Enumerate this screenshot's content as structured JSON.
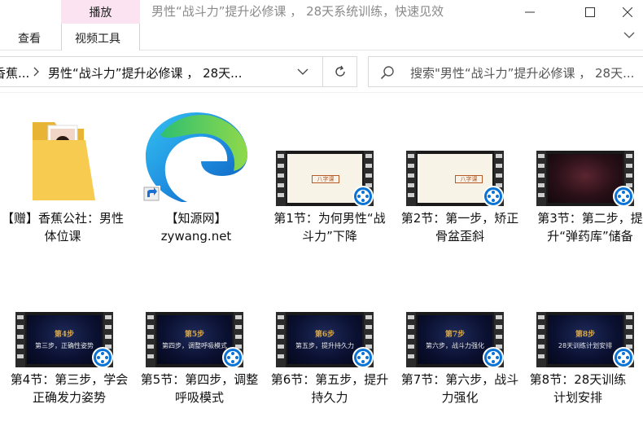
{
  "window": {
    "title": "男性“战斗力”提升必修课 ， 28天系统训练，快速见效",
    "contextual_tab": "播放",
    "minimize_icon": "minimize-icon",
    "maximize_icon": "maximize-icon",
    "close_icon": "close-icon"
  },
  "ribbon": {
    "tabs": [
      "查看",
      "视频工具"
    ]
  },
  "address": {
    "crumbs": [
      "香蕉...",
      "男性“战斗力”提升必修课 ， 28天..."
    ]
  },
  "search": {
    "placeholder": "搜索\"男性“战斗力”提升必修课 ， 28天..."
  },
  "items": [
    {
      "label": "【赠】香蕉公社：男性体位课",
      "type": "folder"
    },
    {
      "label": "【知源网】zywang.net",
      "type": "shortcut"
    },
    {
      "label": "第1节：为何男性“战斗力”下降",
      "type": "video"
    },
    {
      "label": "第2节：第一步，矫正骨盆歪斜",
      "type": "video"
    },
    {
      "label": "第3节：第二步，提升“弹药库”储备",
      "type": "video"
    },
    {
      "label": "第4节：第三步，学会正确发力姿势",
      "type": "video"
    },
    {
      "label": "第5节：第四步，调整呼吸模式",
      "type": "video"
    },
    {
      "label": "第6节：第五步，提升持久力",
      "type": "video"
    },
    {
      "label": "第7节：第六步，战斗力强化",
      "type": "video"
    },
    {
      "label": "第8节：28天训练计划安排",
      "type": "video"
    }
  ],
  "thumb_text": {
    "v1_banner": "八字课",
    "v2_banner": "八字课",
    "v4_title": "第4步",
    "v4_sub": "第三步，正确性姿势",
    "v5_title": "第5步",
    "v5_sub": "第四步，调整呼吸模式",
    "v6_title": "第6步",
    "v6_sub": "第五步，提升持久力",
    "v7_title": "第7步",
    "v7_sub": "第六步，战斗力强化",
    "v8_title": "第8步",
    "v8_sub": "28天训练计划安排"
  },
  "colors": {
    "accent": "#0a74d6",
    "contextual_tab_bg": "#fbe3f1",
    "folder": "#f4c542"
  }
}
